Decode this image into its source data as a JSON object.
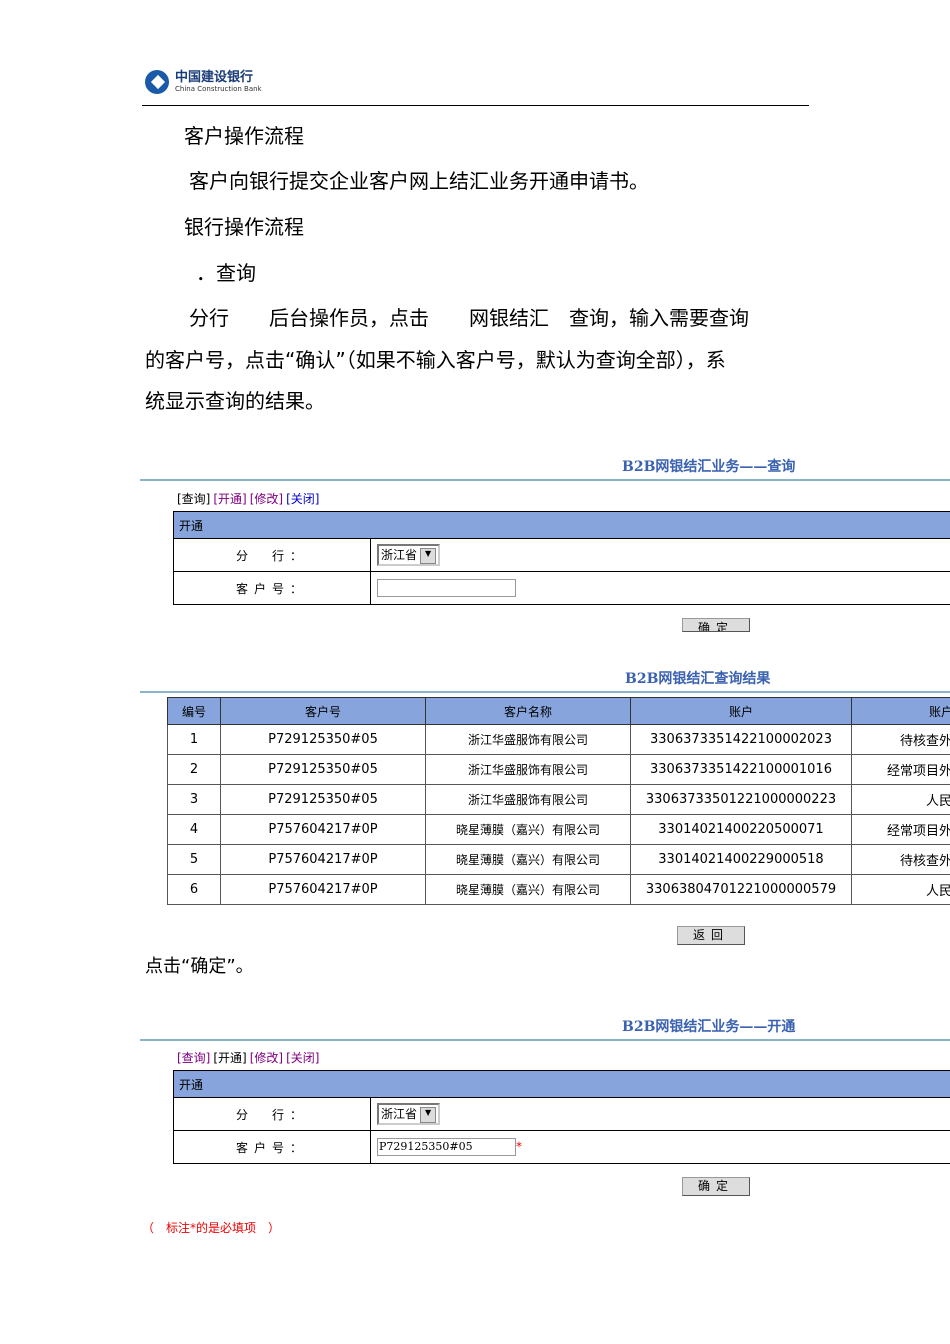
{
  "logo": {
    "cn": "中国建设银行",
    "en": "China Construction Bank"
  },
  "paragraphs": [
    "客户操作流程",
    "客户向银行提交企业客户网上结汇业务开通申请书。",
    "银行操作流程",
    "．查询",
    "分行　　后台操作员，点击　　网银结汇　查询，输入需要查询",
    "的客户号，点击“确认”（如果不输入客户号，默认为查询全部），系",
    "统显示查询的结果。"
  ],
  "screen1": {
    "title": "B2B网银结汇业务——查询",
    "toolbar": [
      "[查询]",
      "[开通]",
      "[修改]",
      "[关闭]"
    ],
    "form_header": "开通",
    "branch_label": "分　行：",
    "branch_value": "浙江省",
    "customer_label": "客户号：",
    "customer_value": "",
    "confirm": "确定"
  },
  "results": {
    "title": "B2B网银结汇查询结果",
    "headers": [
      "编号",
      "客户号",
      "客户名称",
      "账户",
      "账户类"
    ],
    "rows": [
      [
        "1",
        "P729125350#05",
        "浙江华盛服饰有限公司",
        "3306373351422100002023",
        "待核查外汇"
      ],
      [
        "2",
        "P729125350#05",
        "浙江华盛服饰有限公司",
        "3306373351422100001016",
        "经常项目外汇"
      ],
      [
        "3",
        "P729125350#05",
        "浙江华盛服饰有限公司",
        "33063733501221000000223",
        "人民币"
      ],
      [
        "4",
        "P757604217#0P",
        "晓星薄膜（嘉兴）有限公司",
        "33014021400220500071",
        "经常项目外汇"
      ],
      [
        "5",
        "P757604217#0P",
        "晓星薄膜（嘉兴）有限公司",
        "33014021400229000518",
        "待核查外汇"
      ],
      [
        "6",
        "P757604217#0P",
        "晓星薄膜（嘉兴）有限公司",
        "33063804701221000000579",
        "人民币"
      ]
    ],
    "back": "返回"
  },
  "after_text": "点击“确定”。",
  "screen2": {
    "title": "B2B网银结汇业务——开通",
    "toolbar": [
      "[查询]",
      "[开通]",
      "[修改]",
      "[关闭]"
    ],
    "form_header": "开通",
    "branch_label": "分　行：",
    "branch_value": "浙江省",
    "customer_label": "客户号：",
    "customer_value": "P729125350#05",
    "required_mark": "*",
    "confirm": "确定",
    "note": "（　标注*的是必填项　）"
  }
}
